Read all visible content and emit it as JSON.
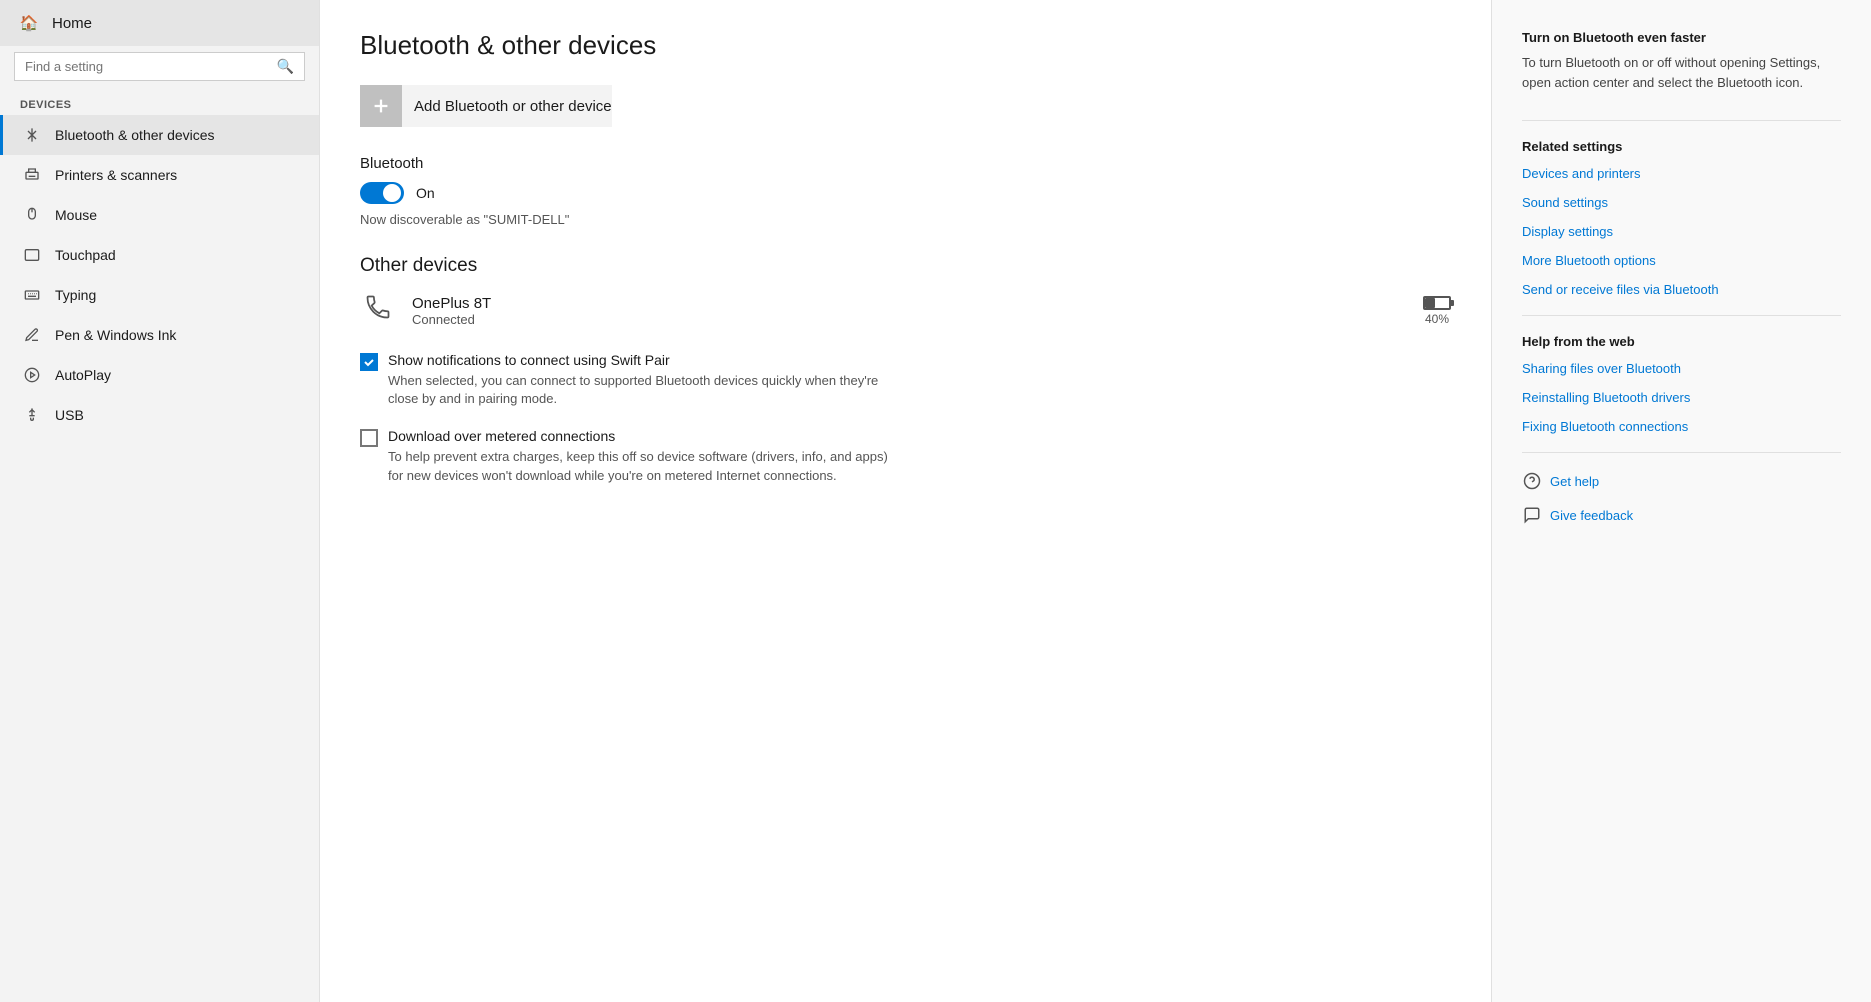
{
  "sidebar": {
    "home_label": "Home",
    "search_placeholder": "Find a setting",
    "search_icon": "🔍",
    "section_label": "Devices",
    "items": [
      {
        "id": "bluetooth",
        "label": "Bluetooth & other devices",
        "icon": "📶",
        "active": true
      },
      {
        "id": "printers",
        "label": "Printers & scanners",
        "icon": "🖨️",
        "active": false
      },
      {
        "id": "mouse",
        "label": "Mouse",
        "icon": "🖱️",
        "active": false
      },
      {
        "id": "touchpad",
        "label": "Touchpad",
        "icon": "⬜",
        "active": false
      },
      {
        "id": "typing",
        "label": "Typing",
        "icon": "⌨️",
        "active": false
      },
      {
        "id": "pen",
        "label": "Pen & Windows Ink",
        "icon": "✏️",
        "active": false
      },
      {
        "id": "autoplay",
        "label": "AutoPlay",
        "icon": "▶️",
        "active": false
      },
      {
        "id": "usb",
        "label": "USB",
        "icon": "🔌",
        "active": false
      }
    ]
  },
  "main": {
    "page_title": "Bluetooth & other devices",
    "add_device_label": "Add Bluetooth or other device",
    "bluetooth_section_title": "Bluetooth",
    "toggle_state": "On",
    "discoverable_text": "Now discoverable as \"SUMIT-DELL\"",
    "other_devices_title": "Other devices",
    "device": {
      "name": "OnePlus 8T",
      "status": "Connected",
      "battery_percent": "40%"
    },
    "swift_pair": {
      "title": "Show notifications to connect using Swift Pair",
      "description": "When selected, you can connect to supported Bluetooth devices quickly when they're close by and in pairing mode.",
      "checked": true
    },
    "download_metered": {
      "title": "Download over metered connections",
      "description": "To help prevent extra charges, keep this off so device software (drivers, info, and apps) for new devices won't download while you're on metered Internet connections.",
      "checked": false
    }
  },
  "right_panel": {
    "tip_title": "Turn on Bluetooth even faster",
    "tip_text": "To turn Bluetooth on or off without opening Settings, open action center and select the Bluetooth icon.",
    "related_settings_title": "Related settings",
    "related_links": [
      {
        "id": "devices-printers",
        "label": "Devices and printers"
      },
      {
        "id": "sound-settings",
        "label": "Sound settings"
      },
      {
        "id": "display-settings",
        "label": "Display settings"
      },
      {
        "id": "more-bluetooth",
        "label": "More Bluetooth options"
      },
      {
        "id": "send-receive",
        "label": "Send or receive files via Bluetooth"
      }
    ],
    "help_from_web_title": "Help from the web",
    "help_links": [
      {
        "id": "sharing-files",
        "label": "Sharing files over Bluetooth",
        "icon": "web"
      },
      {
        "id": "reinstalling-drivers",
        "label": "Reinstalling Bluetooth drivers",
        "icon": "web"
      },
      {
        "id": "fixing-connections",
        "label": "Fixing Bluetooth connections",
        "icon": "web"
      }
    ],
    "get_help_label": "Get help",
    "give_feedback_label": "Give feedback"
  }
}
